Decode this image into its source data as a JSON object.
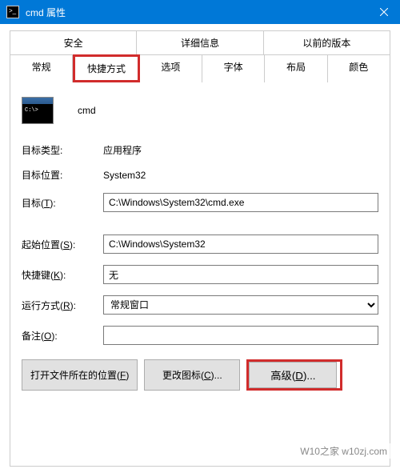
{
  "titlebar": {
    "title": "cmd 属性"
  },
  "tabs": {
    "row1": [
      "安全",
      "详细信息",
      "以前的版本"
    ],
    "row2": [
      "常规",
      "快捷方式",
      "选项",
      "字体",
      "布局",
      "颜色"
    ]
  },
  "app": {
    "name": "cmd"
  },
  "fields": {
    "target_type_label": "目标类型:",
    "target_type_value": "应用程序",
    "target_loc_label": "目标位置:",
    "target_loc_value": "System32",
    "target_label": "目标(T):",
    "target_value": "C:\\Windows\\System32\\cmd.exe",
    "start_in_label": "起始位置(S):",
    "start_in_value": "C:\\Windows\\System32",
    "shortcut_key_label": "快捷键(K):",
    "shortcut_key_value": "无",
    "run_label": "运行方式(R):",
    "run_value": "常规窗口",
    "comment_label": "备注(O):",
    "comment_value": ""
  },
  "buttons": {
    "open_location": "打开文件所在的位置(F)",
    "change_icon": "更改图标(C)...",
    "advanced": "高级(D)..."
  },
  "watermark": "W10之家 w10zj.com"
}
